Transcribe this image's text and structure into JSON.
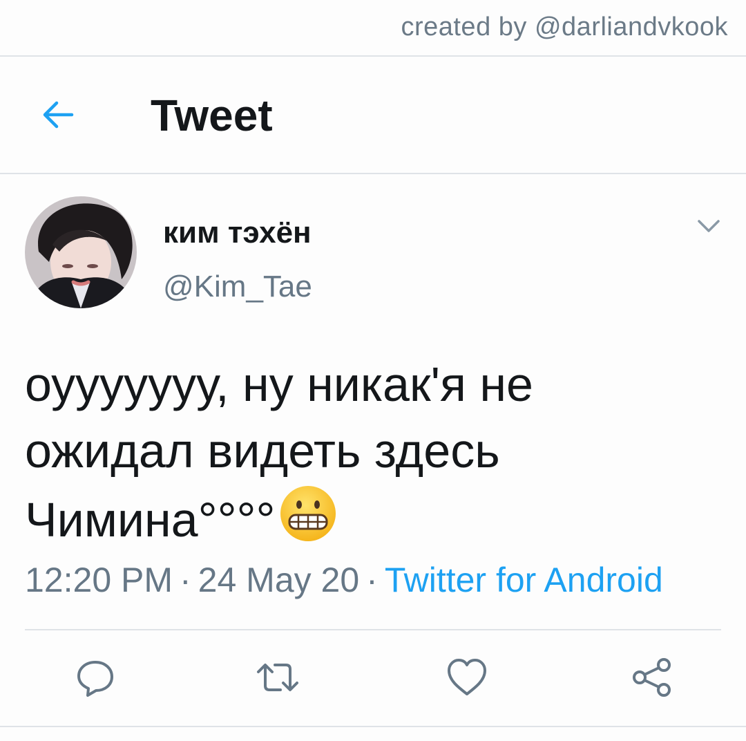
{
  "credit": "created by @darliandvkook",
  "header": {
    "title": "Tweet",
    "back_icon": "arrow-left-icon"
  },
  "tweet": {
    "display_name": "ким тэхён",
    "handle": "@Kim_Tae",
    "text_lines": [
      "оууууууу, ну никак'я не",
      "ожидал видеть здесь",
      "Чимина°°°°"
    ],
    "emoji": "grimacing-face",
    "time": "12:20 PM",
    "separator": "·",
    "date": "24 May 20",
    "source": "Twitter for Android"
  },
  "actions": {
    "reply_icon": "reply-icon",
    "retweet_icon": "retweet-icon",
    "like_icon": "heart-icon",
    "share_icon": "share-icon"
  },
  "colors": {
    "accent": "#1da1f2",
    "text": "#14171a",
    "muted": "#667786",
    "divider": "#dfe3e7"
  }
}
